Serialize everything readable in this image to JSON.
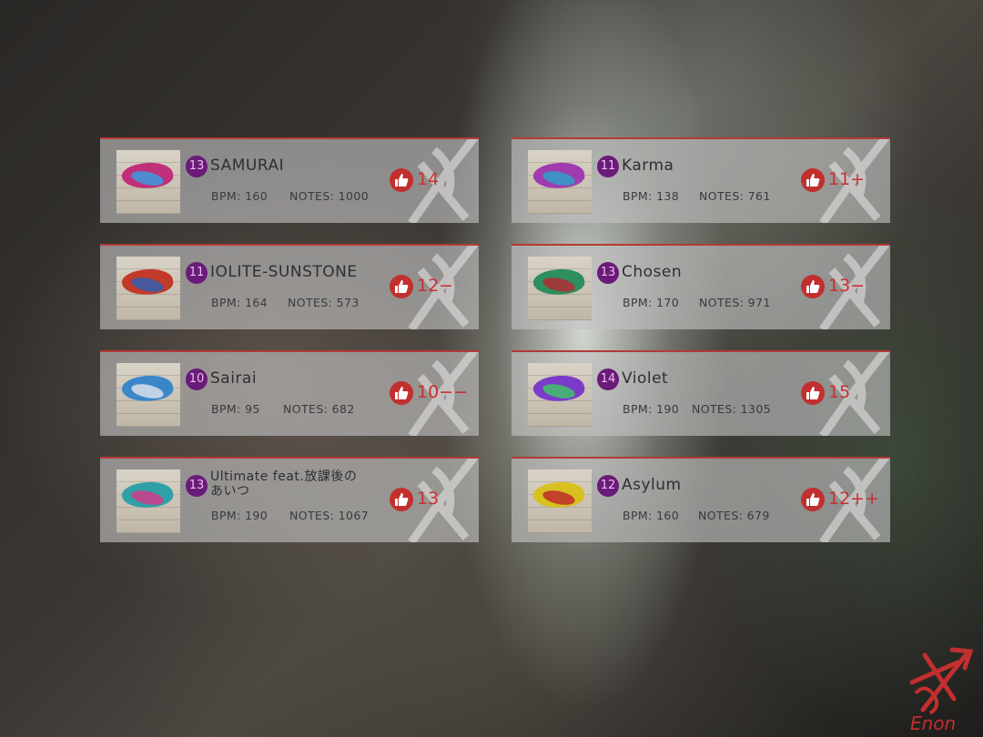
{
  "songs": [
    {
      "title": "SAMURAI",
      "level": "13",
      "bpm": "BPM: 160",
      "notes": "NOTES: 1000",
      "rating": "14",
      "level_color": "#6a1a78",
      "thumb": [
        "#c0307a",
        "#3a9be0"
      ]
    },
    {
      "title": "Karma",
      "level": "11",
      "bpm": "BPM: 138",
      "notes": "NOTES: 761",
      "rating": "11+",
      "level_color": "#6a1a78",
      "thumb": [
        "#a03bb0",
        "#2fa0c8"
      ]
    },
    {
      "title": "IOLITE-SUNSTONE",
      "level": "11",
      "bpm": "BPM: 164",
      "notes": "NOTES: 573",
      "rating": "12−",
      "level_color": "#6a1a78",
      "thumb": [
        "#c23a2a",
        "#2f5fb0"
      ]
    },
    {
      "title": "Chosen",
      "level": "13",
      "bpm": "BPM: 170",
      "notes": "NOTES: 971",
      "rating": "13−",
      "level_color": "#6a1a78",
      "thumb": [
        "#2e8f5e",
        "#b02d35"
      ]
    },
    {
      "title": "Sairai",
      "level": "10",
      "bpm": "BPM: 95",
      "notes": "NOTES: 682",
      "rating": "10−−",
      "level_color": "#6a1a78",
      "thumb": [
        "#3a86c8",
        "#d8dfe8"
      ]
    },
    {
      "title": "Violet",
      "level": "14",
      "bpm": "BPM: 190",
      "notes": "NOTES: 1305",
      "rating": "15",
      "level_color": "#6a1a78",
      "thumb": [
        "#7a3cc8",
        "#3fc26a"
      ]
    },
    {
      "title": "Ultimate feat.放課後のあいつ",
      "level": "13",
      "bpm": "BPM: 190",
      "notes": "NOTES: 1067",
      "rating": "13",
      "level_color": "#6a1a78",
      "thumb": [
        "#2fa0a8",
        "#d13a8a"
      ]
    },
    {
      "title": "Asylum",
      "level": "12",
      "bpm": "BPM: 160",
      "notes": "NOTES: 679",
      "rating": "12++",
      "level_color": "#6a1a78",
      "thumb": [
        "#d8c020",
        "#c02a2a"
      ]
    }
  ],
  "icons": {
    "rating_icon": "thumbs-up-icon",
    "brand_logo": "enon-logo"
  },
  "colors": {
    "accent": "#c12f2f",
    "level_badge": "#6a1a78",
    "card_border": "#b43a36"
  },
  "brand": {
    "logo_text": "Enon"
  }
}
